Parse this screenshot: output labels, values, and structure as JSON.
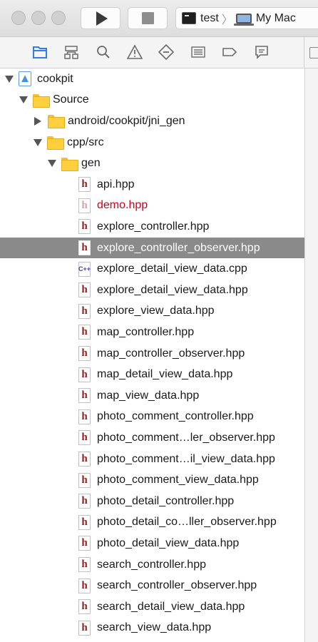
{
  "toolbar": {
    "scheme_target": "test",
    "destination": "My Mac",
    "chevron": "〉"
  },
  "navigator_tabs": [
    {
      "icon": "folder-icon",
      "active": true
    },
    {
      "icon": "hierarchy-icon",
      "active": false
    },
    {
      "icon": "search-icon",
      "active": false
    },
    {
      "icon": "warning-icon",
      "active": false
    },
    {
      "icon": "test-diamond-icon",
      "active": false
    },
    {
      "icon": "debug-list-icon",
      "active": false
    },
    {
      "icon": "breakpoint-icon",
      "active": false
    },
    {
      "icon": "report-icon",
      "active": false
    }
  ],
  "colors": {
    "accent": "#2d7ff0",
    "selection": "#8a8a8a",
    "missing_file": "#d0021b"
  },
  "tree": {
    "project": "cookpit",
    "source_group": "Source",
    "android_group": "android/cookpit/jni_gen",
    "cpp_group": "cpp/src",
    "gen_group": "gen",
    "files": [
      {
        "name": "api.hpp",
        "kind": "h"
      },
      {
        "name": "demo.hpp",
        "kind": "h",
        "missing": true
      },
      {
        "name": "explore_controller.hpp",
        "kind": "h"
      },
      {
        "name": "explore_controller_observer.hpp",
        "kind": "h",
        "selected": true
      },
      {
        "name": "explore_detail_view_data.cpp",
        "kind": "cpp"
      },
      {
        "name": "explore_detail_view_data.hpp",
        "kind": "h"
      },
      {
        "name": "explore_view_data.hpp",
        "kind": "h"
      },
      {
        "name": "map_controller.hpp",
        "kind": "h"
      },
      {
        "name": "map_controller_observer.hpp",
        "kind": "h"
      },
      {
        "name": "map_detail_view_data.hpp",
        "kind": "h"
      },
      {
        "name": "map_view_data.hpp",
        "kind": "h"
      },
      {
        "name": "photo_comment_controller.hpp",
        "kind": "h"
      },
      {
        "name": "photo_comment…ler_observer.hpp",
        "kind": "h"
      },
      {
        "name": "photo_comment…il_view_data.hpp",
        "kind": "h"
      },
      {
        "name": "photo_comment_view_data.hpp",
        "kind": "h"
      },
      {
        "name": "photo_detail_controller.hpp",
        "kind": "h"
      },
      {
        "name": "photo_detail_co…ller_observer.hpp",
        "kind": "h"
      },
      {
        "name": "photo_detail_view_data.hpp",
        "kind": "h"
      },
      {
        "name": "search_controller.hpp",
        "kind": "h"
      },
      {
        "name": "search_controller_observer.hpp",
        "kind": "h"
      },
      {
        "name": "search_detail_view_data.hpp",
        "kind": "h"
      },
      {
        "name": "search_view_data.hpp",
        "kind": "h"
      }
    ],
    "file_glyph_h": "h",
    "file_glyph_cpp": "C++"
  }
}
